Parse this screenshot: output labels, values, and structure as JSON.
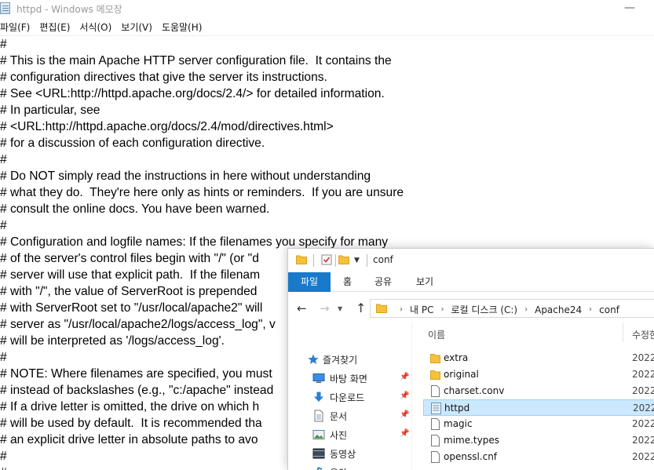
{
  "notepad": {
    "title": "httpd - Windows 메모장",
    "minimize_glyph": "—",
    "menu": [
      "파일(F)",
      "편집(E)",
      "서식(O)",
      "보기(V)",
      "도움말(H)"
    ],
    "lines": [
      "#",
      "# This is the main Apache HTTP server configuration file.  It contains the",
      "# configuration directives that give the server its instructions.",
      "# See <URL:http://httpd.apache.org/docs/2.4/> for detailed information.",
      "# In particular, see",
      "# <URL:http://httpd.apache.org/docs/2.4/mod/directives.html>",
      "# for a discussion of each configuration directive.",
      "#",
      "# Do NOT simply read the instructions in here without understanding",
      "# what they do.  They're here only as hints or reminders.  If you are unsure",
      "# consult the online docs. You have been warned.",
      "#",
      "# Configuration and logfile names: If the filenames you specify for many",
      "# of the server's control files begin with \"/\" (or \"d",
      "# server will use that explicit path.  If the filenam",
      "# with \"/\", the value of ServerRoot is prepended",
      "# with ServerRoot set to \"/usr/local/apache2\" will",
      "# server as \"/usr/local/apache2/logs/access_log\", v",
      "# will be interpreted as '/logs/access_log'.",
      "#",
      "# NOTE: Where filenames are specified, you must",
      "# instead of backslashes (e.g., \"c:/apache\" instead",
      "# If a drive letter is omitted, the drive on which h",
      "# will be used by default.  It is recommended tha",
      "# an explicit drive letter in absolute paths to avo",
      "#",
      "#"
    ]
  },
  "explorer": {
    "title": "conf",
    "ribbon_tabs": [
      "파일",
      "홈",
      "공유",
      "보기"
    ],
    "breadcrumb": [
      "내 PC",
      "로컬 디스크 (C:)",
      "Apache24",
      "conf"
    ],
    "nav_items": [
      {
        "label": "즐겨찾기",
        "icon": "star-icon"
      },
      {
        "label": "바탕 화면",
        "icon": "desktop-icon"
      },
      {
        "label": "다운로드",
        "icon": "download-icon"
      },
      {
        "label": "문서",
        "icon": "document-icon"
      },
      {
        "label": "사진",
        "icon": "picture-icon"
      },
      {
        "label": "동영상",
        "icon": "video-icon"
      },
      {
        "label": "음악",
        "icon": "music-icon"
      }
    ],
    "columns": {
      "name": "이름",
      "modified": "수정한"
    },
    "files": [
      {
        "name": "extra",
        "type": "folder",
        "date": "2022"
      },
      {
        "name": "original",
        "type": "folder",
        "date": "2022"
      },
      {
        "name": "charset.conv",
        "type": "file",
        "date": "2022"
      },
      {
        "name": "httpd",
        "type": "conf-file",
        "date": "2022",
        "selected": true
      },
      {
        "name": "magic",
        "type": "file",
        "date": "2022"
      },
      {
        "name": "mime.types",
        "type": "file",
        "date": "2022"
      },
      {
        "name": "openssl.cnf",
        "type": "file",
        "date": "2022"
      }
    ],
    "colors": {
      "accent": "#1979ca",
      "selection": "#cce8ff",
      "folder": "#f5c13b"
    }
  }
}
